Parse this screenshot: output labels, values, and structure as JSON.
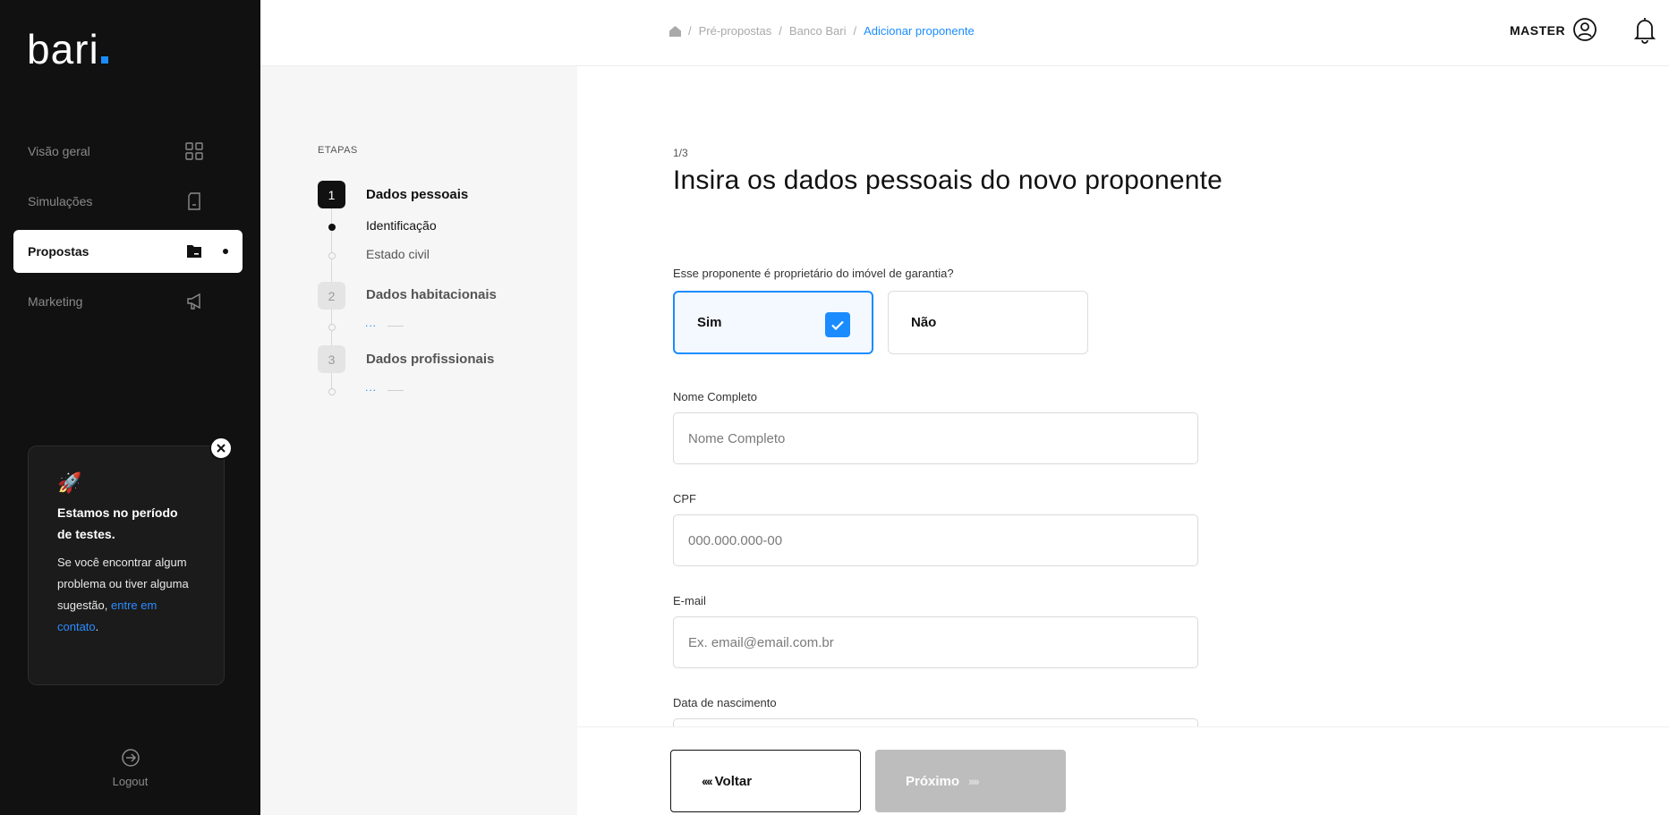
{
  "sidebar": {
    "logo": "bari",
    "items": [
      {
        "label": "Visão geral",
        "icon": "grid-icon"
      },
      {
        "label": "Simulações",
        "icon": "document-icon"
      },
      {
        "label": "Propostas",
        "icon": "folder-icon",
        "active": true
      },
      {
        "label": "Marketing",
        "icon": "megaphone-icon"
      }
    ],
    "promo": {
      "emoji": "🚀",
      "title": "Estamos no período de testes.",
      "text": "Se você encontrar algum problema ou tiver alguma sugestão,",
      "link": "entre em contato",
      "end": "."
    },
    "logout": "Logout"
  },
  "header": {
    "breadcrumb": [
      "Pré-propostas",
      "Banco Bari",
      "Adicionar proponente"
    ],
    "user": "MASTER"
  },
  "steps": {
    "title": "ETAPAS",
    "items": [
      {
        "number": "1",
        "label": "Dados pessoais",
        "substeps": [
          "Identificação",
          "Estado civil"
        ]
      },
      {
        "number": "2",
        "label": "Dados habitacionais",
        "substeps": [
          "..."
        ]
      },
      {
        "number": "3",
        "label": "Dados profissionais",
        "substeps": [
          "..."
        ]
      }
    ]
  },
  "form": {
    "counter": "1/3",
    "title": "Insira os dados pessoais do novo proponente",
    "question": "Esse proponente é proprietário do imóvel de garantia?",
    "options": {
      "yes": "Sim",
      "no": "Não"
    },
    "fields": {
      "name": {
        "label": "Nome Completo",
        "placeholder": "Nome Completo"
      },
      "cpf": {
        "label": "CPF",
        "placeholder": "000.000.000-00"
      },
      "email": {
        "label": "E-mail",
        "placeholder": "Ex. email@email.com.br"
      },
      "birth": {
        "label": "Data de nascimento"
      }
    }
  },
  "footer": {
    "back": "Voltar",
    "next": "Próximo",
    "back_arrows": "‹‹‹‹",
    "next_arrows": "››››"
  },
  "colors": {
    "accent": "#1a8cff",
    "sidebar": "#111111",
    "disabled": "#bdbdbd"
  }
}
